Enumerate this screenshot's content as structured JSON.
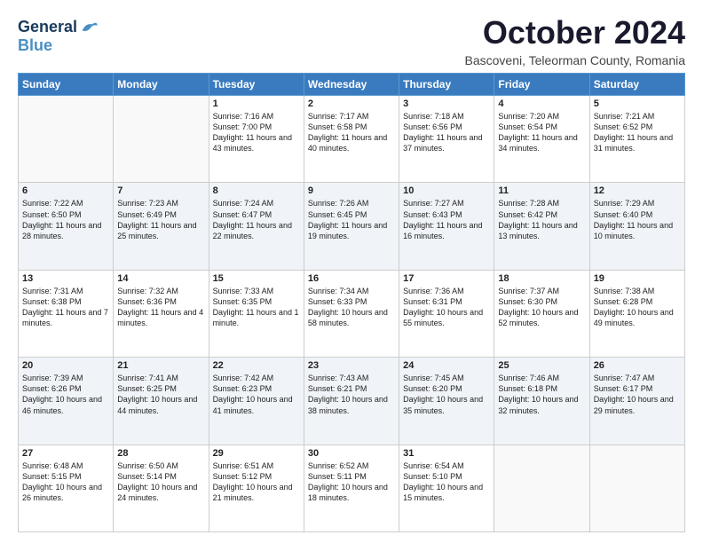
{
  "logo": {
    "line1": "General",
    "line2": "Blue"
  },
  "header": {
    "month": "October 2024",
    "location": "Bascoveni, Teleorman County, Romania"
  },
  "weekdays": [
    "Sunday",
    "Monday",
    "Tuesday",
    "Wednesday",
    "Thursday",
    "Friday",
    "Saturday"
  ],
  "weeks": [
    [
      {
        "day": "",
        "text": ""
      },
      {
        "day": "",
        "text": ""
      },
      {
        "day": "1",
        "text": "Sunrise: 7:16 AM\nSunset: 7:00 PM\nDaylight: 11 hours and 43 minutes."
      },
      {
        "day": "2",
        "text": "Sunrise: 7:17 AM\nSunset: 6:58 PM\nDaylight: 11 hours and 40 minutes."
      },
      {
        "day": "3",
        "text": "Sunrise: 7:18 AM\nSunset: 6:56 PM\nDaylight: 11 hours and 37 minutes."
      },
      {
        "day": "4",
        "text": "Sunrise: 7:20 AM\nSunset: 6:54 PM\nDaylight: 11 hours and 34 minutes."
      },
      {
        "day": "5",
        "text": "Sunrise: 7:21 AM\nSunset: 6:52 PM\nDaylight: 11 hours and 31 minutes."
      }
    ],
    [
      {
        "day": "6",
        "text": "Sunrise: 7:22 AM\nSunset: 6:50 PM\nDaylight: 11 hours and 28 minutes."
      },
      {
        "day": "7",
        "text": "Sunrise: 7:23 AM\nSunset: 6:49 PM\nDaylight: 11 hours and 25 minutes."
      },
      {
        "day": "8",
        "text": "Sunrise: 7:24 AM\nSunset: 6:47 PM\nDaylight: 11 hours and 22 minutes."
      },
      {
        "day": "9",
        "text": "Sunrise: 7:26 AM\nSunset: 6:45 PM\nDaylight: 11 hours and 19 minutes."
      },
      {
        "day": "10",
        "text": "Sunrise: 7:27 AM\nSunset: 6:43 PM\nDaylight: 11 hours and 16 minutes."
      },
      {
        "day": "11",
        "text": "Sunrise: 7:28 AM\nSunset: 6:42 PM\nDaylight: 11 hours and 13 minutes."
      },
      {
        "day": "12",
        "text": "Sunrise: 7:29 AM\nSunset: 6:40 PM\nDaylight: 11 hours and 10 minutes."
      }
    ],
    [
      {
        "day": "13",
        "text": "Sunrise: 7:31 AM\nSunset: 6:38 PM\nDaylight: 11 hours and 7 minutes."
      },
      {
        "day": "14",
        "text": "Sunrise: 7:32 AM\nSunset: 6:36 PM\nDaylight: 11 hours and 4 minutes."
      },
      {
        "day": "15",
        "text": "Sunrise: 7:33 AM\nSunset: 6:35 PM\nDaylight: 11 hours and 1 minute."
      },
      {
        "day": "16",
        "text": "Sunrise: 7:34 AM\nSunset: 6:33 PM\nDaylight: 10 hours and 58 minutes."
      },
      {
        "day": "17",
        "text": "Sunrise: 7:36 AM\nSunset: 6:31 PM\nDaylight: 10 hours and 55 minutes."
      },
      {
        "day": "18",
        "text": "Sunrise: 7:37 AM\nSunset: 6:30 PM\nDaylight: 10 hours and 52 minutes."
      },
      {
        "day": "19",
        "text": "Sunrise: 7:38 AM\nSunset: 6:28 PM\nDaylight: 10 hours and 49 minutes."
      }
    ],
    [
      {
        "day": "20",
        "text": "Sunrise: 7:39 AM\nSunset: 6:26 PM\nDaylight: 10 hours and 46 minutes."
      },
      {
        "day": "21",
        "text": "Sunrise: 7:41 AM\nSunset: 6:25 PM\nDaylight: 10 hours and 44 minutes."
      },
      {
        "day": "22",
        "text": "Sunrise: 7:42 AM\nSunset: 6:23 PM\nDaylight: 10 hours and 41 minutes."
      },
      {
        "day": "23",
        "text": "Sunrise: 7:43 AM\nSunset: 6:21 PM\nDaylight: 10 hours and 38 minutes."
      },
      {
        "day": "24",
        "text": "Sunrise: 7:45 AM\nSunset: 6:20 PM\nDaylight: 10 hours and 35 minutes."
      },
      {
        "day": "25",
        "text": "Sunrise: 7:46 AM\nSunset: 6:18 PM\nDaylight: 10 hours and 32 minutes."
      },
      {
        "day": "26",
        "text": "Sunrise: 7:47 AM\nSunset: 6:17 PM\nDaylight: 10 hours and 29 minutes."
      }
    ],
    [
      {
        "day": "27",
        "text": "Sunrise: 6:48 AM\nSunset: 5:15 PM\nDaylight: 10 hours and 26 minutes."
      },
      {
        "day": "28",
        "text": "Sunrise: 6:50 AM\nSunset: 5:14 PM\nDaylight: 10 hours and 24 minutes."
      },
      {
        "day": "29",
        "text": "Sunrise: 6:51 AM\nSunset: 5:12 PM\nDaylight: 10 hours and 21 minutes."
      },
      {
        "day": "30",
        "text": "Sunrise: 6:52 AM\nSunset: 5:11 PM\nDaylight: 10 hours and 18 minutes."
      },
      {
        "day": "31",
        "text": "Sunrise: 6:54 AM\nSunset: 5:10 PM\nDaylight: 10 hours and 15 minutes."
      },
      {
        "day": "",
        "text": ""
      },
      {
        "day": "",
        "text": ""
      }
    ]
  ]
}
